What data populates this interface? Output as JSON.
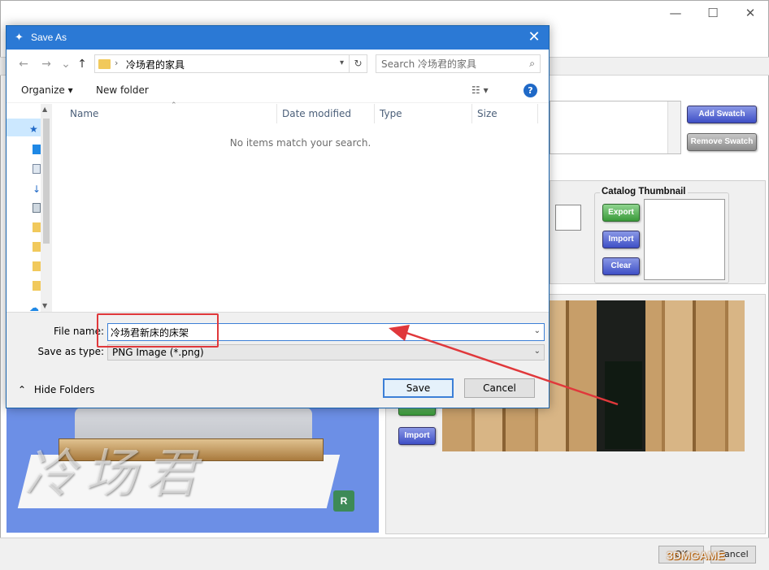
{
  "dialog": {
    "title": "Save As",
    "close_glyph": "✕",
    "nav": {
      "back_glyph": "←",
      "forward_glyph": "→",
      "recent_glyph": "⌄",
      "up_glyph": "↑",
      "path_chevron": "›",
      "path": "冷场君的家具",
      "refresh_glyph": "↻",
      "search_placeholder": "Search 冷场君的家具"
    },
    "toolbar": {
      "organize_label": "Organize ▾",
      "new_folder_label": "New folder",
      "view_label": "☷ ▾",
      "help_label": "?"
    },
    "columns": [
      "Name",
      "Date modified",
      "Type",
      "Size"
    ],
    "empty_message": "No items match your search.",
    "file_name_label": "File name:",
    "file_name_value": "冷场君新床的床架",
    "save_type_label": "Save as type:",
    "save_type_value": "PNG Image (*.png)",
    "hide_folders_label": "Hide Folders",
    "save_label": "Save",
    "cancel_label": "Cancel"
  },
  "app": {
    "window_controls": [
      "—",
      "☐",
      "✕"
    ],
    "add_swatch_label": "Add Swatch",
    "remove_swatch_label": "Remove Swatch",
    "catalog_thumbnail_title": "Catalog Thumbnail",
    "export_label": "Export",
    "import_label": "Import",
    "clear_label": "Clear",
    "import2_label": "Import",
    "preview_watermark": "冷场君",
    "logo_letter": "R",
    "footer_ok": "OK",
    "footer_cancel": "Cancel",
    "site_watermark": "3DMGAME"
  },
  "colors": {
    "titlebar": "#2b79d5",
    "annotation": "#e0383b",
    "button_blue": "#3e4fc6",
    "button_green": "#3a9a3a",
    "preview_bg": "#6c8fe6"
  }
}
